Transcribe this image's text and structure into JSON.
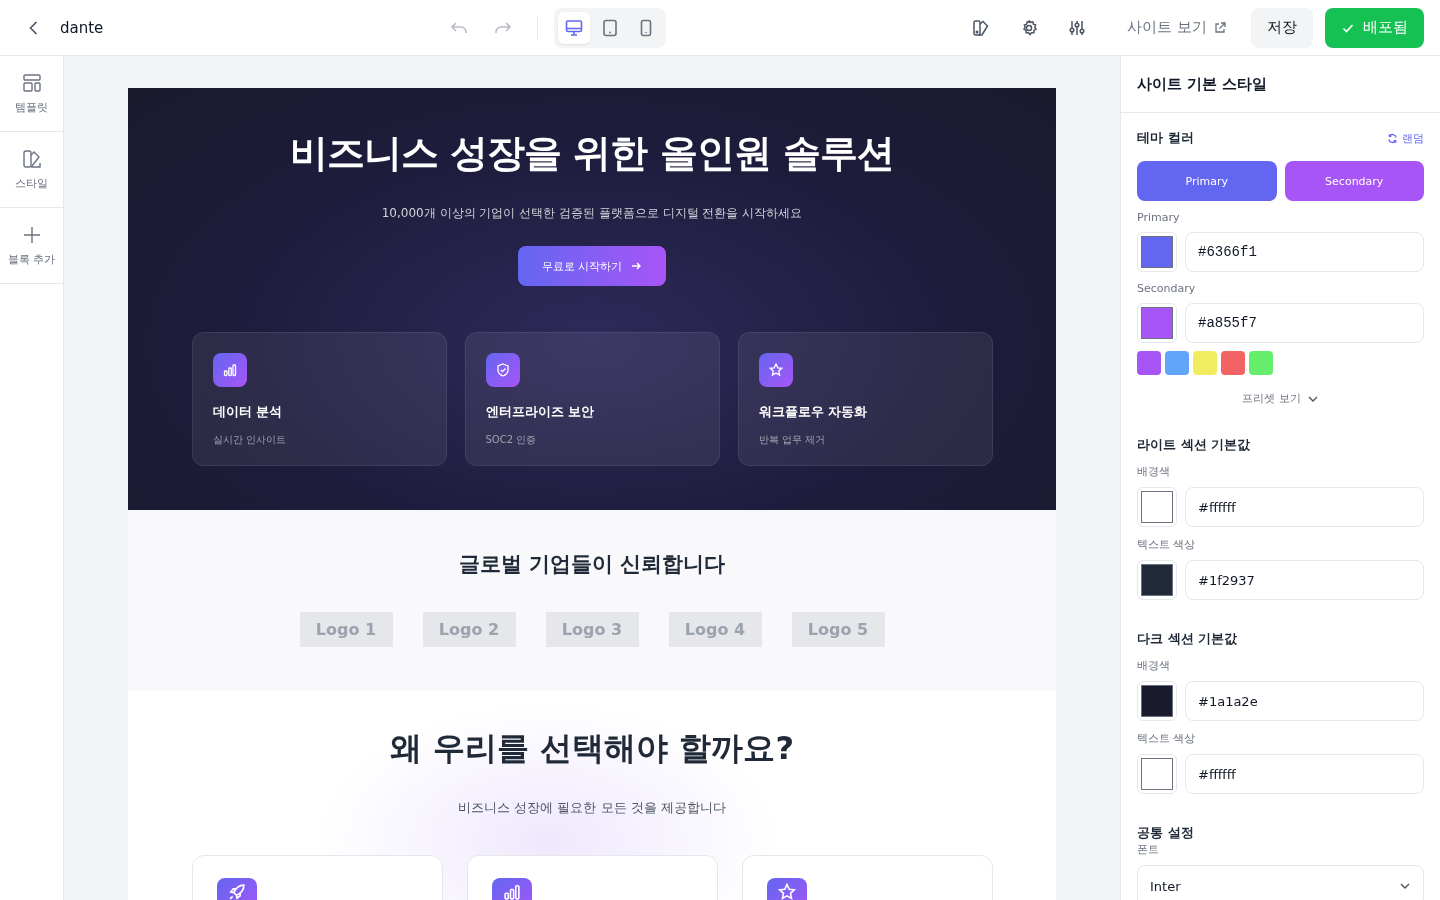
{
  "topbar": {
    "project": "dante",
    "devices": [
      {
        "kind": "desktop",
        "selected": true
      },
      {
        "kind": "tablet",
        "selected": false
      },
      {
        "kind": "mobile",
        "selected": false
      }
    ],
    "site_view": "사이트 보기",
    "save": "저장",
    "deploy": "배포됨"
  },
  "left_rail": [
    {
      "kind": "template",
      "label": "템플릿"
    },
    {
      "kind": "style",
      "label": "스타일"
    },
    {
      "kind": "add",
      "label": "블록 추가"
    }
  ],
  "hero": {
    "title": "비즈니스 성장을 위한 올인원 솔루션",
    "subtitle": "10,000개 이상의 기업이 선택한 검증된 플랫폼으로 디지털 전환을 시작하세요",
    "cta": "무료로 시작하기",
    "features": [
      {
        "kind": "chart",
        "title": "데이터 분석",
        "subtitle": "실시간 인사이트"
      },
      {
        "kind": "shield",
        "title": "엔터프라이즈 보안",
        "subtitle": "SOC2 인증"
      },
      {
        "kind": "star",
        "title": "워크플로우 자동화",
        "subtitle": "반복 업무 제거"
      }
    ]
  },
  "trust": {
    "title": "글로벌 기업들이 신뢰합니다",
    "logos": [
      "Logo 1",
      "Logo 2",
      "Logo 3",
      "Logo 4",
      "Logo 5"
    ]
  },
  "why": {
    "title": "왜 우리를 선택해야 할까요?",
    "subtitle": "비즈니스 성장에 필요한 모든 것을 제공합니다",
    "cards": [
      {
        "kind": "rocket"
      },
      {
        "kind": "chart"
      },
      {
        "kind": "star"
      }
    ]
  },
  "panel": {
    "title": "사이트 기본 스타일",
    "theme": {
      "title": "테마 컬러",
      "random": "랜덤",
      "buttons": [
        {
          "label": "Primary",
          "color": "#6366f1"
        },
        {
          "label": "Secondary",
          "color": "#a855f7"
        }
      ],
      "fields": [
        {
          "label": "Primary",
          "value": "#6366f1"
        },
        {
          "label": "Secondary",
          "value": "#a855f7"
        }
      ],
      "presets": [
        {
          "color": "#a855f7"
        },
        {
          "color": "#60a5fa"
        },
        {
          "color": "#f2ec5f"
        },
        {
          "color": "#f26464"
        },
        {
          "color": "#66ed6c"
        }
      ],
      "preset_toggle": "프리셋 보기"
    },
    "sections": [
      {
        "title": "라이트 섹션 기본값",
        "fields": [
          {
            "label": "배경색",
            "value": "#ffffff"
          },
          {
            "label": "텍스트 색상",
            "value": "#1f2937"
          }
        ]
      },
      {
        "title": "다크 섹션 기본값",
        "fields": [
          {
            "label": "배경색",
            "value": "#1a1a2e"
          },
          {
            "label": "텍스트 색상",
            "value": "#ffffff"
          }
        ]
      }
    ],
    "common": {
      "title": "공통 설정",
      "font_label": "폰트",
      "font": "Inter"
    }
  }
}
